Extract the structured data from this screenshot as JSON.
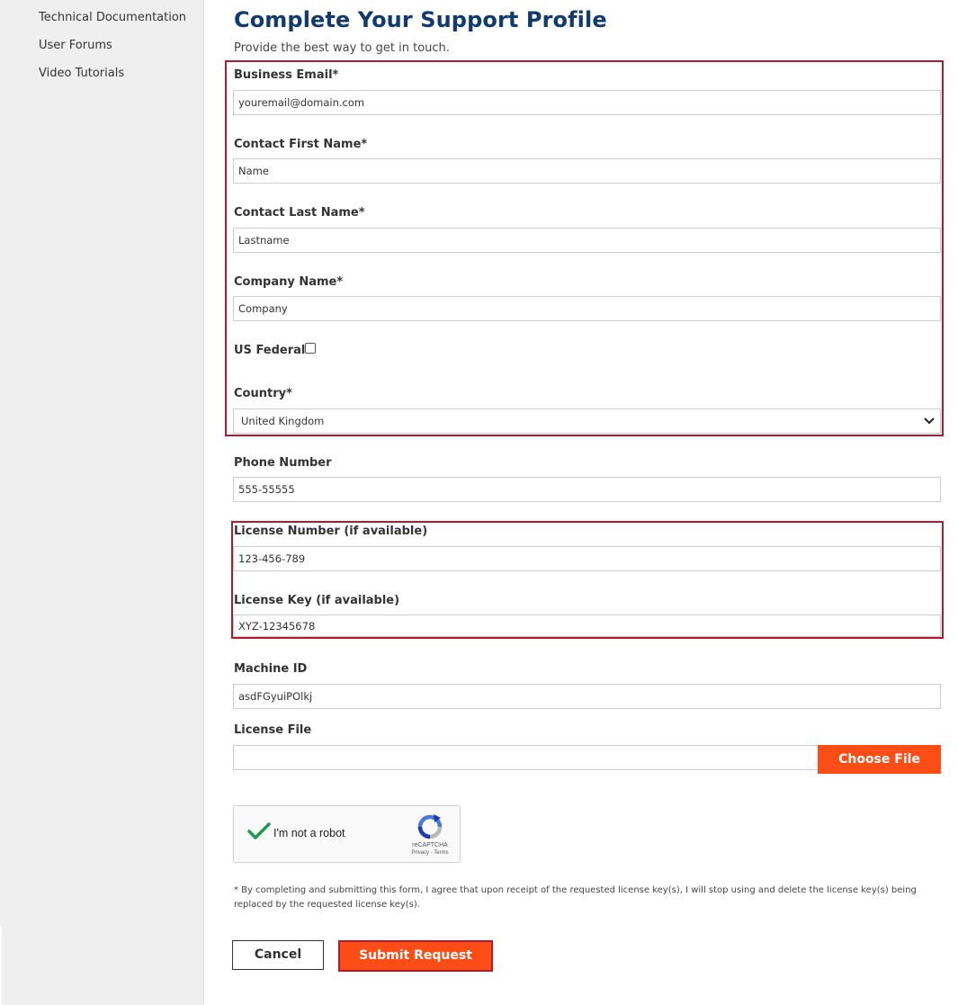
{
  "sidebar": {
    "items": [
      "Technical Documentation",
      "User Forums",
      "Video Tutorials"
    ]
  },
  "form": {
    "title": "Complete Your Support Profile",
    "subtitle": "Provide the best way to get in touch.",
    "business_email": {
      "label": "Business Email*",
      "value": "youremail@domain.com"
    },
    "first_name": {
      "label": "Contact First Name*",
      "value": "Name"
    },
    "last_name": {
      "label": "Contact Last Name*",
      "value": "Lastname"
    },
    "company": {
      "label": "Company Name*",
      "value": "Company"
    },
    "us_federal": {
      "label": "US Federal",
      "checked": false
    },
    "country": {
      "label": "Country*",
      "value": "United Kingdom"
    },
    "phone": {
      "label": "Phone Number",
      "value": "555-55555"
    },
    "license_number": {
      "label": "License Number (if available)",
      "value": "123-456-789"
    },
    "license_key": {
      "label": "License Key (if available)",
      "value": "XYZ-12345678"
    },
    "machine_id": {
      "label": "Machine ID",
      "value": "asdFGyuiPOlkj"
    },
    "license_file": {
      "label": "License File",
      "button": "Choose File"
    },
    "captcha": {
      "label": "I'm not a robot",
      "brand": "reCAPTCHA",
      "links": "Privacy - Terms"
    },
    "disclaimer": "* By completing and submitting this form, I agree that upon receipt of the requested license key(s), I will stop using and delete the license key(s) being replaced by the requested license key(s).",
    "cancel": "Cancel",
    "submit": "Submit Request"
  },
  "colors": {
    "title": "#123b6d",
    "accent": "#fc4d16",
    "highlight": "#b01c2e",
    "sidebar_bg": "#efefef"
  }
}
